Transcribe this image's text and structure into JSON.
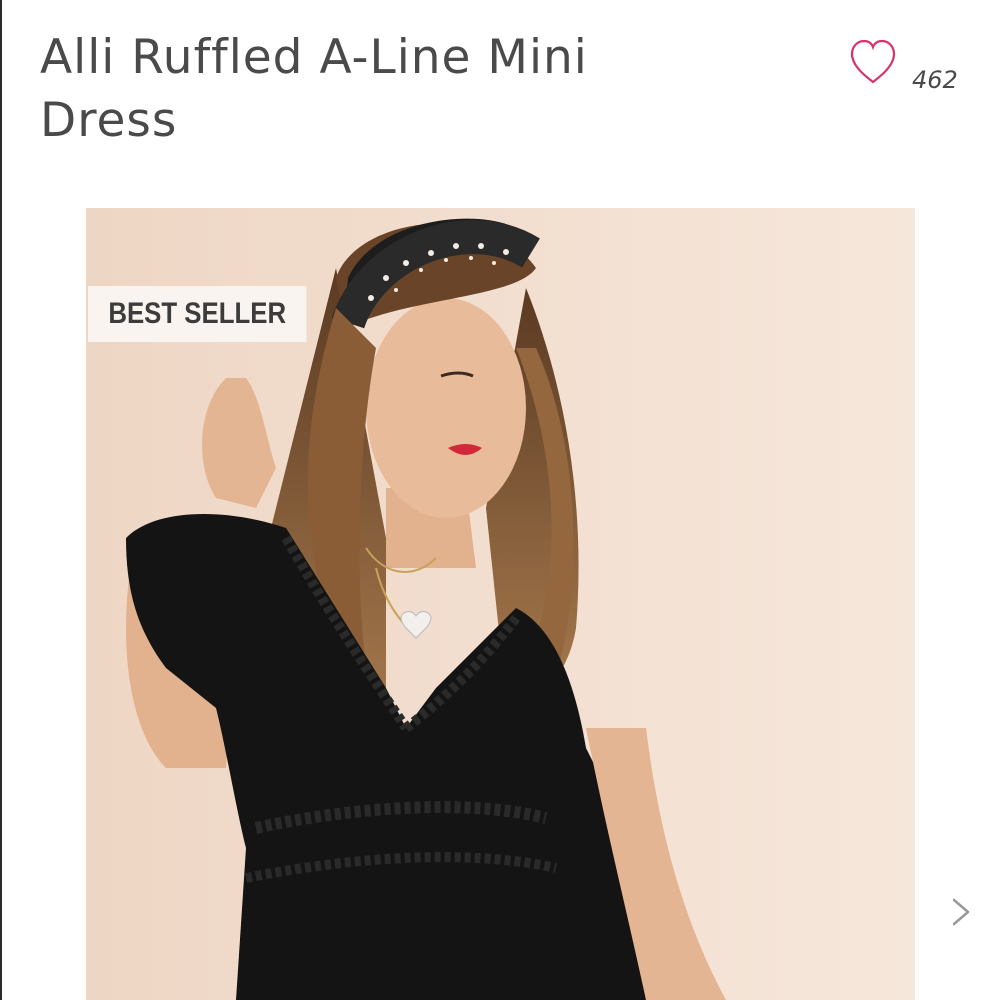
{
  "product": {
    "title": "Alli Ruffled A-Line Mini Dress"
  },
  "favorite": {
    "icon": "heart-outline-icon",
    "count": "462",
    "color": "#d6336c"
  },
  "gallery": {
    "badge_label": "BEST SELLER",
    "image": "model-wearing-black-ruffled-dress",
    "next_icon": "chevron-right-icon"
  },
  "colors": {
    "title_text": "#4a4a4a",
    "photo_background": "#f1dccb",
    "dress": "#141414"
  }
}
